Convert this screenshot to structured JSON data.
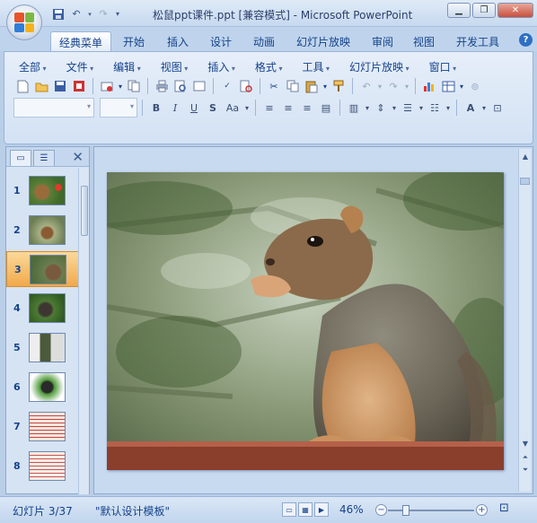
{
  "window": {
    "title": "松鼠ppt课件.ppt [兼容模式] - Microsoft PowerPoint"
  },
  "ribbon_tabs": [
    "经典菜单",
    "开始",
    "插入",
    "设计",
    "动画",
    "幻灯片放映",
    "审阅",
    "视图",
    "开发工具"
  ],
  "classic_menus": [
    "全部",
    "文件",
    "编辑",
    "视图",
    "插入",
    "格式",
    "工具",
    "幻灯片放映",
    "窗口"
  ],
  "slides_pane": {
    "slide_numbers": [
      "1",
      "2",
      "3",
      "4",
      "5",
      "6",
      "7",
      "8"
    ],
    "selected_index": 3
  },
  "status_bar": {
    "slide_indicator": "幻灯片 3/37",
    "template": "\"默认设计模板\"",
    "zoom": "46%"
  },
  "accent": {
    "selected_thumb": "#f1a94a",
    "ribbon_blue": "#15428b"
  }
}
